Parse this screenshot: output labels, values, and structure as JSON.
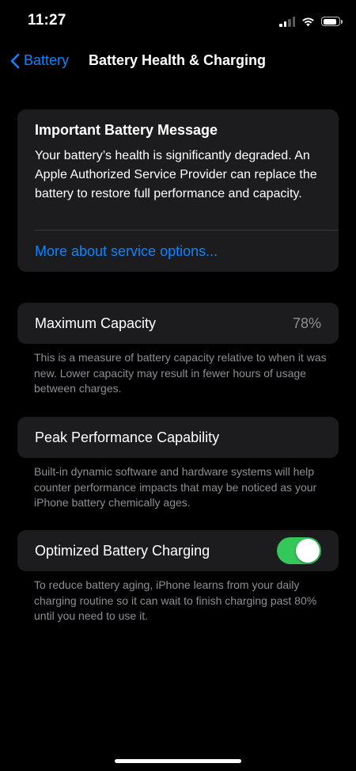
{
  "status_bar": {
    "time": "11:27",
    "battery_level": 0.85
  },
  "nav": {
    "back_label": "Battery",
    "title": "Battery Health & Charging"
  },
  "message_card": {
    "title": "Important Battery Message",
    "body": "Your battery’s health is significantly degraded. An Apple Authorized Service Provider can replace the battery to restore full performance and capacity.",
    "link": "More about service options..."
  },
  "maximum_capacity": {
    "label": "Maximum Capacity",
    "value": "78%",
    "footnote": "This is a measure of battery capacity relative to when it was new. Lower capacity may result in fewer hours of usage between charges."
  },
  "peak_performance": {
    "label": "Peak Performance Capability",
    "footnote": "Built-in dynamic software and hardware systems will help counter performance impacts that may be noticed as your iPhone battery chemically ages."
  },
  "optimized_charging": {
    "label": "Optimized Battery Charging",
    "enabled": true,
    "footnote": "To reduce battery aging, iPhone learns from your daily charging routine so it can wait to finish charging past 80% until you need to use it."
  },
  "colors": {
    "accent": "#0a84ff",
    "toggle_on": "#34c759",
    "card_background": "#1c1c1e",
    "secondary_text": "#8e8e93"
  },
  "icons": {
    "back": "chevron-left-icon",
    "signal": "cellular-signal-icon",
    "wifi": "wifi-icon",
    "battery": "battery-icon"
  }
}
